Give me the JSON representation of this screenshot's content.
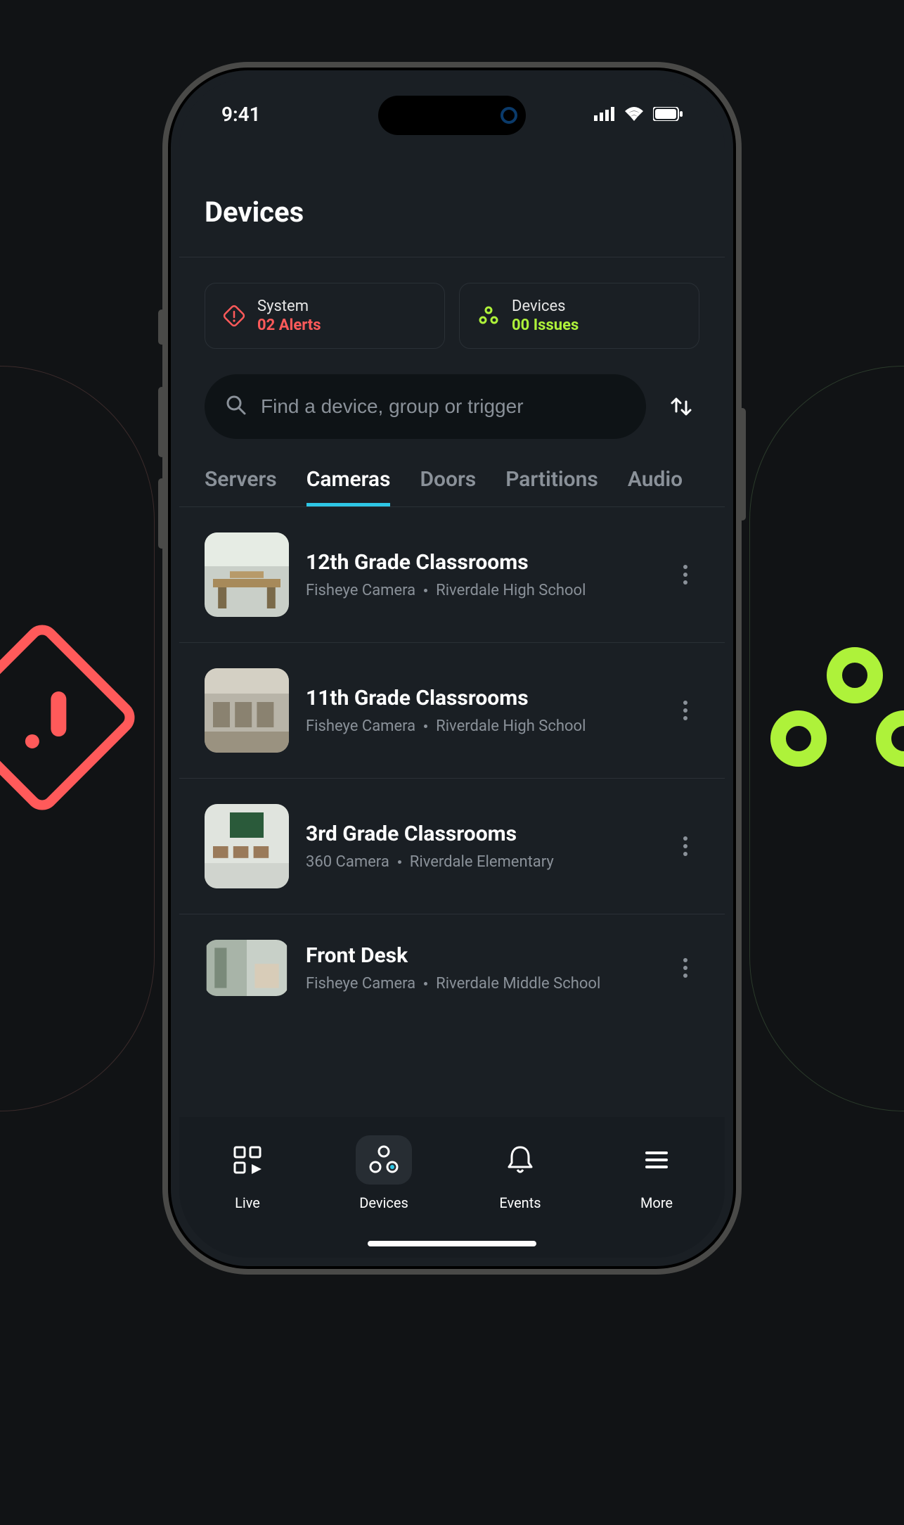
{
  "statusbar": {
    "time": "9:41"
  },
  "page": {
    "title": "Devices"
  },
  "status_cards": {
    "system": {
      "label": "System",
      "value": "02 Alerts"
    },
    "devices": {
      "label": "Devices",
      "value": "00 Issues"
    }
  },
  "search": {
    "placeholder": "Find a device, group or trigger"
  },
  "tabs": {
    "items": [
      {
        "label": "Servers",
        "active": false
      },
      {
        "label": "Cameras",
        "active": true
      },
      {
        "label": "Doors",
        "active": false
      },
      {
        "label": "Partitions",
        "active": false
      },
      {
        "label": "Audio",
        "active": false
      }
    ]
  },
  "cameras": [
    {
      "title": "12th Grade Classrooms",
      "type": "Fisheye Camera",
      "location": "Riverdale High School"
    },
    {
      "title": "11th Grade Classrooms",
      "type": "Fisheye Camera",
      "location": "Riverdale High School"
    },
    {
      "title": "3rd Grade Classrooms",
      "type": "360 Camera",
      "location": "Riverdale Elementary"
    },
    {
      "title": "Front Desk",
      "type": "Fisheye Camera",
      "location": "Riverdale Middle School"
    }
  ],
  "bottom_nav": {
    "items": [
      {
        "label": "Live"
      },
      {
        "label": "Devices"
      },
      {
        "label": "Events"
      },
      {
        "label": "More"
      }
    ]
  }
}
